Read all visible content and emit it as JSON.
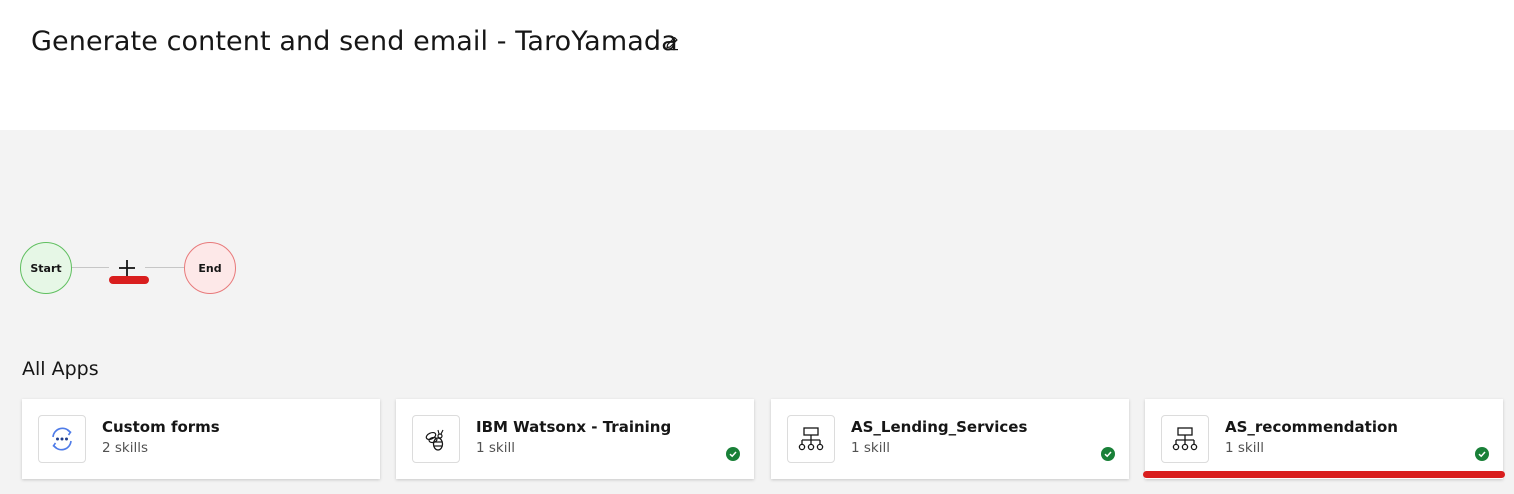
{
  "header": {
    "title": "Generate content and send email - TaroYamada",
    "edit_icon": "pencil-icon"
  },
  "flow": {
    "start_label": "Start",
    "end_label": "End",
    "add_icon": "plus-icon",
    "highlight_color": "#d91e1e"
  },
  "apps": {
    "section_title": "All Apps",
    "cards": [
      {
        "title": "Custom forms",
        "subtitle": "2 skills",
        "icon": "custom-forms-icon",
        "connected": false
      },
      {
        "title": "IBM Watsonx - Training",
        "subtitle": "1 skill",
        "icon": "bee-icon",
        "connected": true
      },
      {
        "title": "AS_Lending_Services",
        "subtitle": "1 skill",
        "icon": "hierarchy-icon",
        "connected": true
      },
      {
        "title": "AS_recommendation",
        "subtitle": "1 skill",
        "icon": "hierarchy-icon",
        "connected": true
      }
    ]
  },
  "colors": {
    "start_fill": "#e6f7e6",
    "end_fill": "#fde8e8",
    "check_green": "#198038",
    "canvas_bg": "#f3f3f3"
  }
}
